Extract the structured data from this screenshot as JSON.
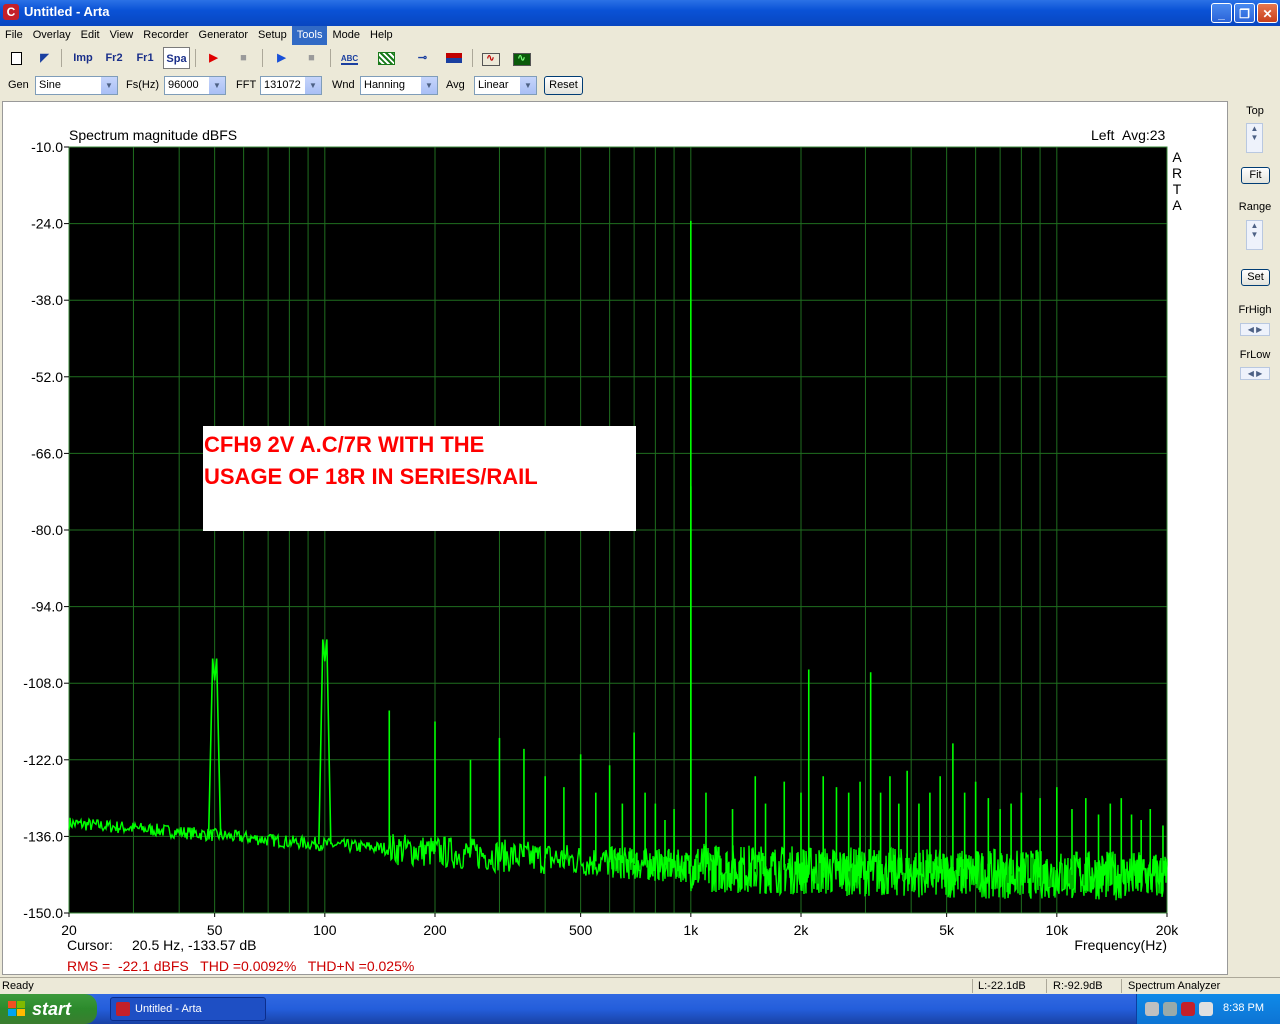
{
  "window": {
    "title": "Untitled - Arta",
    "app_icon": "C"
  },
  "menu": [
    {
      "label": "File"
    },
    {
      "label": "Overlay"
    },
    {
      "label": "Edit"
    },
    {
      "label": "View"
    },
    {
      "label": "Recorder"
    },
    {
      "label": "Generator"
    },
    {
      "label": "Setup"
    },
    {
      "label": "Tools",
      "active": true
    },
    {
      "label": "Mode"
    },
    {
      "label": "Help"
    }
  ],
  "toolbar": {
    "imp": "Imp",
    "fr2": "Fr2",
    "fr1": "Fr1",
    "spa": "Spa",
    "abc": "ABC"
  },
  "genbar": {
    "gen_label": "Gen",
    "gen_value": "Sine",
    "fs_label": "Fs(Hz)",
    "fs_value": "96000",
    "fft_label": "FFT",
    "fft_value": "131072",
    "wnd_label": "Wnd",
    "wnd_value": "Hanning",
    "avg_label": "Avg",
    "avg_value": "Linear",
    "reset_label": "Reset"
  },
  "right_panel": {
    "top_label": "Top",
    "fit_label": "Fit",
    "range_label": "Range",
    "set_label": "Set",
    "frhigh_label": "FrHigh",
    "frlow_label": "FrLow"
  },
  "plot": {
    "left_label": "Left",
    "avg_text": "Avg:23",
    "arta_letters": [
      "A",
      "R",
      "T",
      "A"
    ],
    "cursor_label": "Cursor:",
    "cursor_value": "20.5 Hz, -133.57 dB",
    "stats": "RMS =  -22.1 dBFS   THD =0.0092%   THD+N =0.025%",
    "annotation_line1": "CFH9 2V A.C/7R WITH THE",
    "annotation_line2": "USAGE OF 18R IN SERIES/RAIL",
    "colors": {
      "trace": "#00ff00",
      "grid": "#1f6e1f",
      "background": "#000000",
      "stats": "#cc0000",
      "annotation": "#ff0000"
    }
  },
  "chart_data": {
    "type": "line",
    "title": "Spectrum magnitude dBFS",
    "xlabel": "Frequency(Hz)",
    "ylabel": "",
    "xscale": "log",
    "xlim": [
      20,
      20000
    ],
    "ylim": [
      -150,
      -10
    ],
    "x_ticks": [
      20,
      50,
      100,
      200,
      500,
      1000,
      2000,
      5000,
      10000,
      20000
    ],
    "x_tick_labels": [
      "20",
      "50",
      "100",
      "200",
      "500",
      "1k",
      "2k",
      "5k",
      "10k",
      "20k"
    ],
    "y_ticks": [
      -10,
      -24,
      -38,
      -52,
      -66,
      -80,
      -94,
      -108,
      -122,
      -136,
      -150
    ],
    "y_tick_labels": [
      "-10.0",
      "-24.0",
      "-38.0",
      "-52.0",
      "-66.0",
      "-80.0",
      "-94.0",
      "-108.0",
      "-122.0",
      "-136.0",
      "-150.0"
    ],
    "grid": true,
    "series": [
      {
        "noise_floor": [
          [
            20,
            -133.6
          ],
          [
            30,
            -134.5
          ],
          [
            45,
            -135.5
          ],
          [
            60,
            -136.2
          ],
          [
            80,
            -137
          ],
          [
            120,
            -137.8
          ],
          [
            200,
            -138.8
          ],
          [
            400,
            -140
          ],
          [
            700,
            -141
          ],
          [
            1000,
            -141.5
          ],
          [
            1200,
            -141.8
          ],
          [
            2000,
            -142.2
          ],
          [
            5000,
            -142.8
          ],
          [
            10000,
            -143
          ],
          [
            20000,
            -143.3
          ]
        ],
        "peaks": [
          [
            50,
            -107.5
          ],
          [
            100,
            -104
          ],
          [
            150,
            -113
          ],
          [
            200,
            -115
          ],
          [
            250,
            -122
          ],
          [
            300,
            -118
          ],
          [
            350,
            -120
          ],
          [
            400,
            -125
          ],
          [
            450,
            -127
          ],
          [
            500,
            -121
          ],
          [
            550,
            -128
          ],
          [
            600,
            -123
          ],
          [
            650,
            -130
          ],
          [
            700,
            -117
          ],
          [
            750,
            -128
          ],
          [
            800,
            -130
          ],
          [
            850,
            -133
          ],
          [
            900,
            -131
          ],
          [
            1000,
            -23.5
          ],
          [
            1000,
            -72
          ],
          [
            1100,
            -128
          ],
          [
            1300,
            -131
          ],
          [
            1500,
            -125
          ],
          [
            1600,
            -130
          ],
          [
            1800,
            -126
          ],
          [
            2000,
            -128
          ],
          [
            2100,
            -105.5
          ],
          [
            2300,
            -125
          ],
          [
            2500,
            -127
          ],
          [
            2700,
            -128
          ],
          [
            2900,
            -126
          ],
          [
            3100,
            -106
          ],
          [
            3300,
            -128
          ],
          [
            3500,
            -125
          ],
          [
            3700,
            -130
          ],
          [
            3900,
            -124
          ],
          [
            4200,
            -130
          ],
          [
            4500,
            -128
          ],
          [
            4800,
            -125
          ],
          [
            5200,
            -119
          ],
          [
            5600,
            -128
          ],
          [
            6000,
            -126
          ],
          [
            6500,
            -129
          ],
          [
            7000,
            -131
          ],
          [
            7500,
            -130
          ],
          [
            8000,
            -128
          ],
          [
            9000,
            -129
          ],
          [
            10000,
            -127
          ],
          [
            11000,
            -131
          ],
          [
            12000,
            -129
          ],
          [
            13000,
            -132
          ],
          [
            14000,
            -130
          ],
          [
            15000,
            -129
          ],
          [
            16000,
            -132
          ],
          [
            17000,
            -133
          ],
          [
            18000,
            -131
          ],
          [
            19500,
            -134
          ]
        ]
      }
    ]
  },
  "status": {
    "ready": "Ready",
    "left_level": "L:-22.1dB",
    "right_level": "R:-92.9dB",
    "mode": "Spectrum Analyzer"
  },
  "taskbar": {
    "start": "start",
    "task": "Untitled - Arta",
    "clock": "8:38 PM"
  }
}
